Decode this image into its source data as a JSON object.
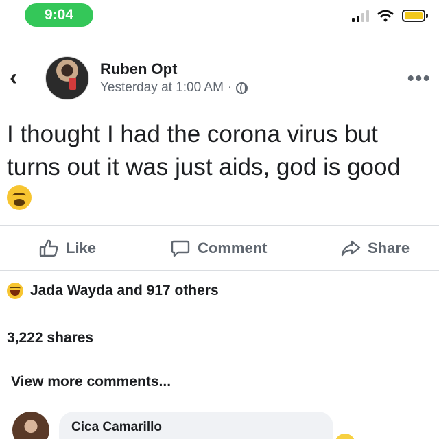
{
  "status_bar": {
    "time": "9:04"
  },
  "post": {
    "author": "Ruben Opt",
    "timestamp": "Yesterday at 1:00 AM",
    "separator": "·",
    "text_line1": "I thought I had the corona virus but",
    "text_line2": "turns out it was just aids, god is good",
    "emoji": "weary-face"
  },
  "actions": {
    "like_label": "Like",
    "comment_label": "Comment",
    "share_label": "Share"
  },
  "engagement": {
    "reactions_text": "Jada Wayda and 917 others",
    "reaction_emoji": "laughing-face",
    "shares_text": "3,222 shares",
    "view_more": "View more comments..."
  },
  "comment_preview": {
    "author": "Cica Camarillo"
  },
  "colors": {
    "time_pill": "#34c759",
    "battery": "#f2c81c",
    "text_primary": "#1c1e21",
    "text_secondary": "#606770",
    "divider": "#dadde1"
  }
}
